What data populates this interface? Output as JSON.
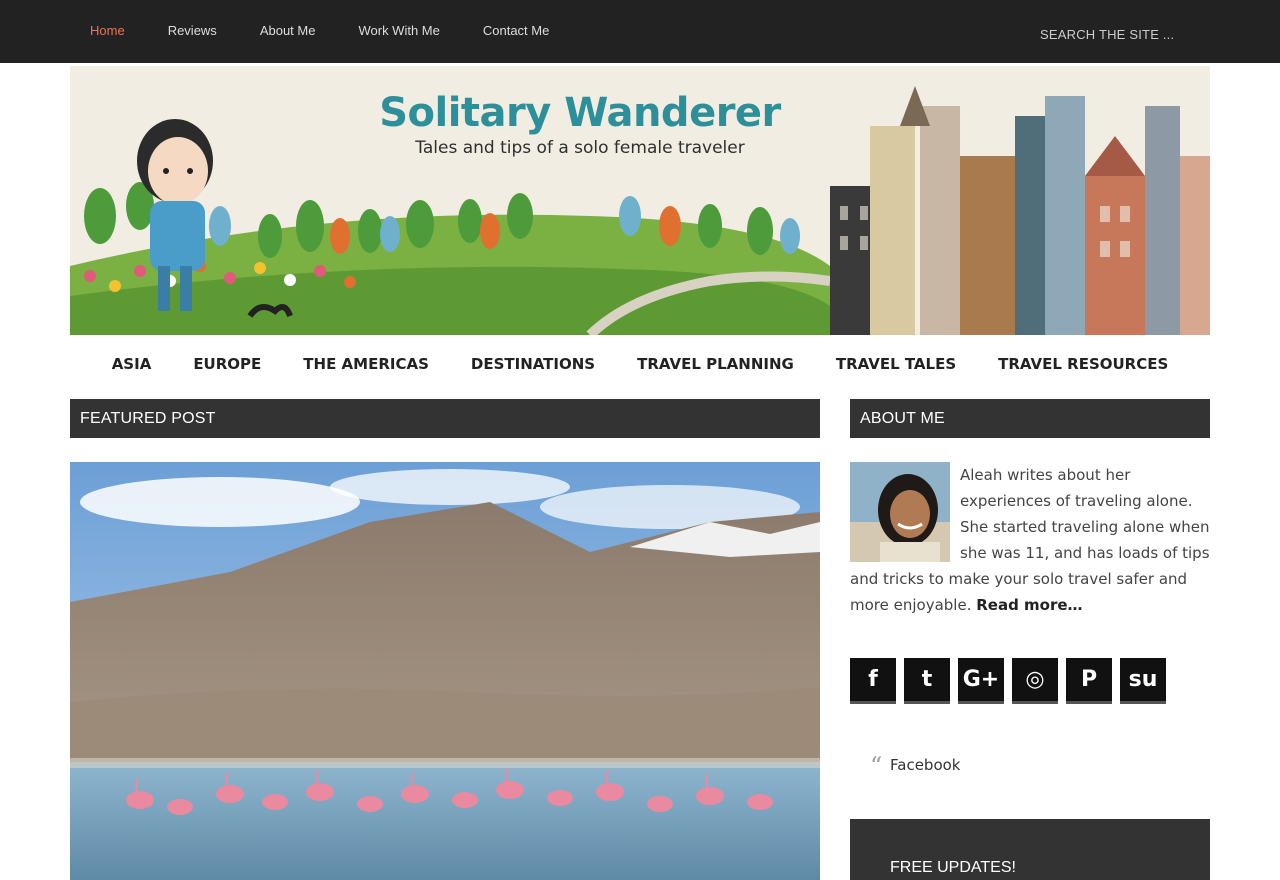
{
  "topnav": {
    "items": [
      {
        "label": "Home"
      },
      {
        "label": "Reviews"
      },
      {
        "label": "About Me"
      },
      {
        "label": "Work With Me"
      },
      {
        "label": "Contact Me"
      }
    ],
    "search_placeholder": "Search the site ..."
  },
  "banner": {
    "title": "Solitary Wanderer",
    "subtitle": "Tales and tips of a solo female traveler"
  },
  "mainnav": {
    "items": [
      {
        "label": "ASIA"
      },
      {
        "label": "EUROPE"
      },
      {
        "label": "THE AMERICAS"
      },
      {
        "label": "DESTINATIONS"
      },
      {
        "label": "TRAVEL PLANNING"
      },
      {
        "label": "TRAVEL TALES"
      },
      {
        "label": "TRAVEL RESOURCES"
      }
    ]
  },
  "featured": {
    "heading": "Featured Post"
  },
  "about": {
    "heading": "About Me",
    "text": "Aleah writes about her experiences of traveling alone. She started traveling alone when she was 11, and has loads of tips and tricks to make your solo travel safer and more enjoyable.",
    "read_more": "Read more…"
  },
  "social": {
    "icons": [
      {
        "name": "facebook-icon",
        "glyph": "f"
      },
      {
        "name": "twitter-icon",
        "glyph": "t"
      },
      {
        "name": "google-plus-icon",
        "glyph": "G+"
      },
      {
        "name": "instagram-icon",
        "glyph": "◎"
      },
      {
        "name": "pinterest-icon",
        "glyph": "P"
      },
      {
        "name": "stumbleupon-icon",
        "glyph": "su"
      }
    ]
  },
  "facebook": {
    "quote": "“",
    "label": "Facebook"
  },
  "updates": {
    "heading": "Free Updates!"
  },
  "colors": {
    "accent": "#f07357",
    "topbar": "#222222",
    "header_bg": "#333333",
    "banner_teal": "#2d8f9a"
  }
}
